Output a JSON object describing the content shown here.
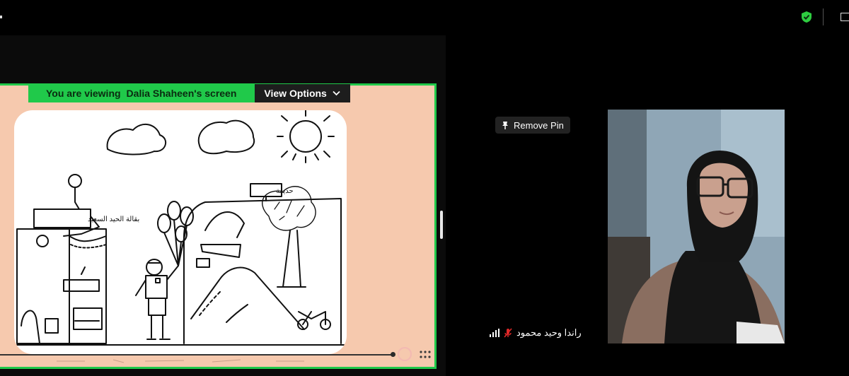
{
  "share": {
    "viewing_prefix": "You are viewing",
    "presenter_screen": "Dalia Shaheen's screen",
    "view_options_label": "View Options"
  },
  "drawing": {
    "shop_sign": "بقالة الحيد السعيد",
    "road_sign": "حديقة"
  },
  "participant": {
    "remove_pin_label": "Remove Pin",
    "name": "راندا وحيد محمود"
  },
  "colors": {
    "share_border": "#20c94a",
    "share_background": "#f6c9ae",
    "security_shield": "#2ecc40",
    "mic_muted": "#e02828"
  },
  "icons": [
    "shield-check-icon",
    "chevron-down-icon",
    "pin-icon",
    "signal-bars-icon",
    "mic-muted-icon",
    "more-dots-icon"
  ]
}
